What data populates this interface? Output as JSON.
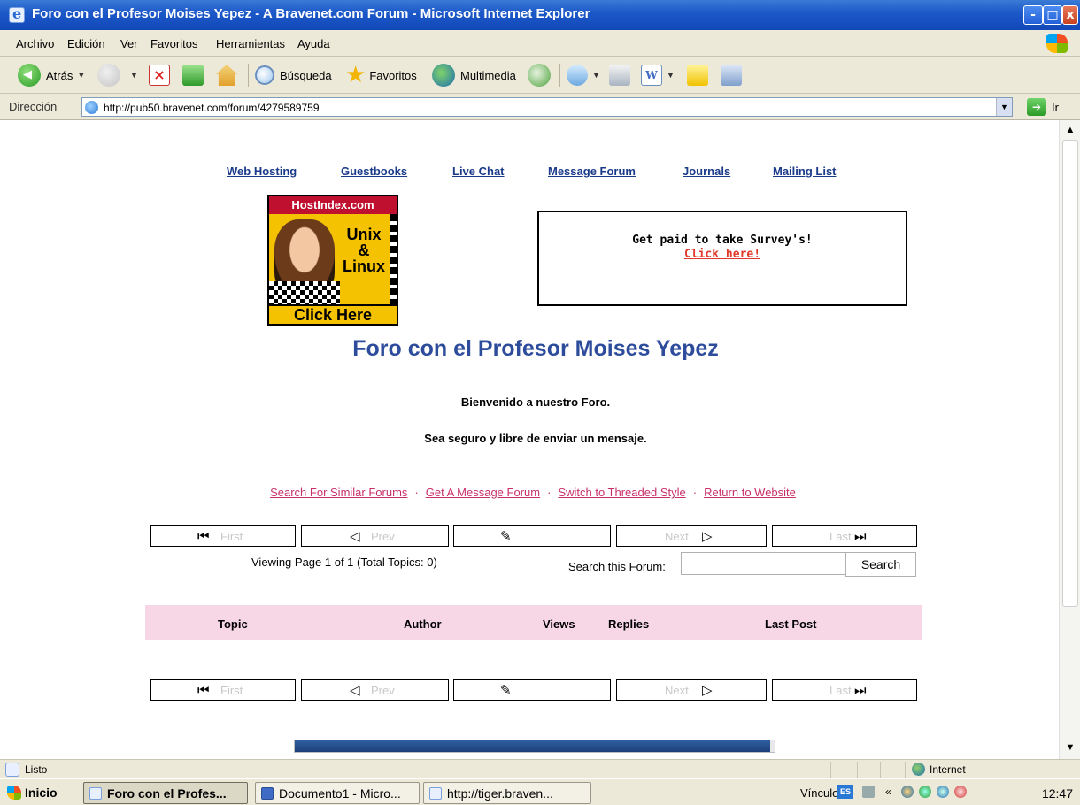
{
  "window": {
    "title": "Foro con el Profesor Moises Yepez - A Bravenet.com Forum - Microsoft Internet Explorer",
    "minimize": "-",
    "maximize": "□",
    "close": "x"
  },
  "menu": [
    "Archivo",
    "Edición",
    "Ver",
    "Favoritos",
    "Herramientas",
    "Ayuda"
  ],
  "toolbar": {
    "back": "Atrás",
    "search": "Búsqueda",
    "favorites": "Favoritos",
    "media": "Multimedia"
  },
  "address": {
    "label": "Dirección",
    "url": "http://pub50.bravenet.com/forum/4279589759",
    "go": "Ir"
  },
  "top_links": [
    "Web Hosting",
    "Guestbooks",
    "Live Chat",
    "Message Forum",
    "Journals",
    "Mailing List"
  ],
  "ad_banner": {
    "header": "HostIndex.com",
    "line1": "Unix",
    "line2": "&",
    "line3": "Linux",
    "cta": "Click Here"
  },
  "survey_ad": {
    "text": "Get paid to take Survey's!",
    "link": "Click here!"
  },
  "forum_title": "Foro con el Profesor Moises Yepez",
  "welcome": {
    "line1": "Bienvenido a nuestro Foro.",
    "line2": "Sea seguro y libre de enviar un mensaje."
  },
  "util_links": [
    "Search For Similar Forums",
    "Get A Message Forum",
    "Switch to Threaded Style",
    "Return to Website"
  ],
  "util_separator": "·",
  "pager": {
    "first": "First",
    "prev": "Prev",
    "next": "Next",
    "last": "Last"
  },
  "viewing": "Viewing Page 1 of 1 (Total Topics: 0)",
  "search": {
    "label": "Search this Forum:",
    "value": "",
    "button": "Search"
  },
  "table_headers": [
    "Topic",
    "Author",
    "Views",
    "Replies",
    "Last Post"
  ],
  "progress": {
    "fraction": 0.99
  },
  "status": {
    "text": "Listo",
    "zone": "Internet"
  },
  "taskbar": {
    "start": "Inicio",
    "tasks": [
      "Foro con el Profes...",
      "Documento1 - Micro...",
      "http://tiger.braven..."
    ],
    "links": "Vínculos",
    "links_chevron": "»",
    "lang": "ES",
    "clock": "12:47"
  },
  "colors": {
    "link_blue": "#1a3a8a",
    "title_blue": "#2d4c9c",
    "util_pink": "#c8306a",
    "header_pink": "#f7d7e6",
    "survey_red": "#e0382a"
  }
}
